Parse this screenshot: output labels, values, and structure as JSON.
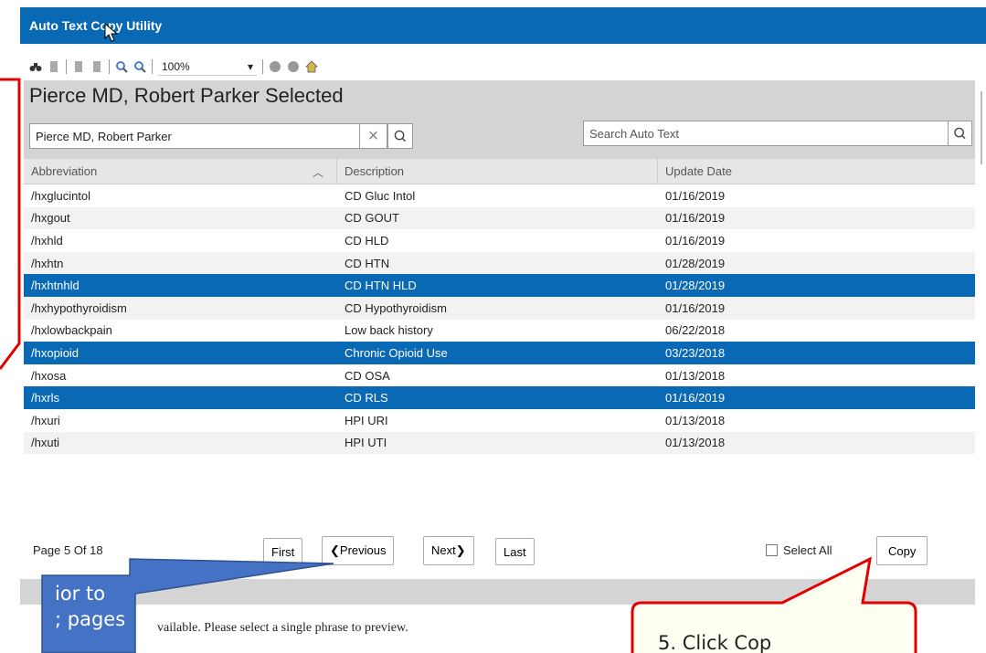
{
  "app": {
    "title": "Auto Text Copy Utility"
  },
  "toolbar": {
    "zoom": "100%"
  },
  "panel": {
    "selected_title": "Pierce MD, Robert Parker Selected",
    "provider_value": "Pierce MD, Robert Parker",
    "search_placeholder": "Search Auto Text"
  },
  "table": {
    "headers": [
      "Abbreviation",
      "Description",
      "Update Date"
    ],
    "rows": [
      {
        "abbr": "/hxglucintol",
        "desc": "CD Gluc Intol",
        "date": "01/16/2019"
      },
      {
        "abbr": "/hxgout",
        "desc": "CD GOUT",
        "date": "01/16/2019"
      },
      {
        "abbr": "/hxhld",
        "desc": "CD HLD",
        "date": "01/16/2019"
      },
      {
        "abbr": "/hxhtn",
        "desc": "CD HTN",
        "date": "01/28/2019"
      },
      {
        "abbr": "/hxhtnhld",
        "desc": "CD HTN HLD",
        "date": "01/28/2019"
      },
      {
        "abbr": "/hxhypothyroidism",
        "desc": "CD Hypothyroidism",
        "date": "01/16/2019"
      },
      {
        "abbr": "/hxlowbackpain",
        "desc": "Low back history",
        "date": "06/22/2018"
      },
      {
        "abbr": "/hxopioid",
        "desc": "Chronic Opioid Use",
        "date": "03/23/2018"
      },
      {
        "abbr": "/hxosa",
        "desc": "CD OSA",
        "date": "01/13/2018"
      },
      {
        "abbr": "/hxrls",
        "desc": "CD RLS",
        "date": "01/16/2019"
      },
      {
        "abbr": "/hxuri",
        "desc": "HPI URI",
        "date": "01/13/2018"
      },
      {
        "abbr": "/hxuti",
        "desc": "HPI UTI",
        "date": "01/13/2018"
      }
    ]
  },
  "pager": {
    "page_info": "Page 5 Of 18",
    "first": "First",
    "previous": "Previous",
    "next": "Next",
    "last": "Last",
    "select_all": "Select All",
    "copy": "Copy"
  },
  "preview": {
    "message": "vailable. Please select a single phrase to preview."
  },
  "callouts": {
    "blue_line1": "ior to",
    "blue_line2": "; pages",
    "red_text": "5. Click Cop"
  },
  "colors": {
    "accent": "#0a69b4",
    "callout_blue": "#4472c4",
    "callout_red": "#e00000"
  }
}
